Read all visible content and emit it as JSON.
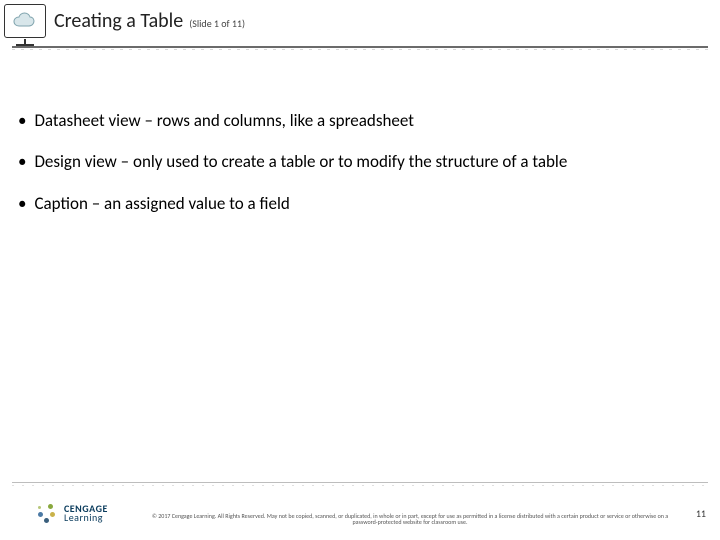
{
  "header": {
    "title": "Creating a Table",
    "subtitle": "(Slide 1 of 11)"
  },
  "bullets": [
    "Datasheet view – rows and columns, like a spreadsheet",
    "Design view – only used to create a table or to modify the structure of a table",
    "Caption – an assigned value to a field"
  ],
  "footer": {
    "logo_top": "CENGAGE",
    "logo_bottom": "Learning",
    "copyright": "© 2017 Cengage Learning. All Rights Reserved. May not be copied, scanned, or duplicated, in whole or in part, except for use as permitted in a license distributed with a certain product or service or otherwise on a password-protected website for classroom use.",
    "page_number": "11"
  }
}
